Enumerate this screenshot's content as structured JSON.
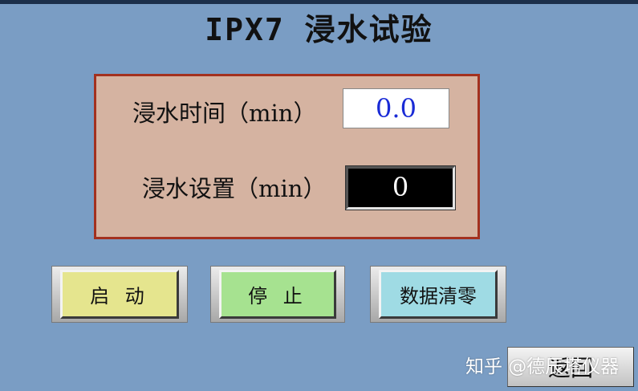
{
  "title": "IPX7 浸水试验",
  "panel": {
    "time_label": "浸水时间（min）",
    "time_value": "0.0",
    "setting_label": "浸水设置（min）",
    "setting_value": "0"
  },
  "buttons": {
    "start": "启 动",
    "stop": "停 止",
    "clear": "数据清零",
    "back": "返回"
  },
  "watermark": "知乎 @德辰塔仪器",
  "colors": {
    "background": "#7a9dc4",
    "panel": "#d5b3a1",
    "panel_border": "#a3311f",
    "value_text": "#1a2bd6",
    "start_button": "#e5e58e",
    "stop_button": "#a6e290",
    "clear_button": "#9fdbe4"
  }
}
